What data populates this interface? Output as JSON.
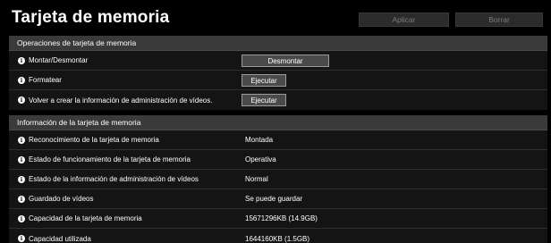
{
  "header": {
    "title": "Tarjeta de memoria",
    "apply_label": "Aplicar",
    "clear_label": "Borrar"
  },
  "operations": {
    "title": "Operaciones de tarjeta de memoria",
    "rows": [
      {
        "label": "Montar/Desmontar",
        "button": "Desmontar"
      },
      {
        "label": "Formatear",
        "button": "Ejecutar"
      },
      {
        "label": "Volver a crear la información de administración de vídeos.",
        "button": "Ejecutar"
      }
    ]
  },
  "info": {
    "title": "Información de la tarjeta de memoria",
    "rows": [
      {
        "label": "Reconocimiento de la tarjeta de memoria",
        "value": "Montada"
      },
      {
        "label": "Estado de funcionamiento de la tarjeta de memoria",
        "value": "Operativa"
      },
      {
        "label": "Estado de la información de administración de vídeos",
        "value": "Normal"
      },
      {
        "label": "Guardado de vídeos",
        "value": "Se puede guardar"
      },
      {
        "label": "Capacidad de la tarjeta de memoria",
        "value": "15671296KB (14.9GB)"
      },
      {
        "label": "Capacidad utilizada",
        "value": "1644160KB (1.5GB)"
      }
    ]
  },
  "icons": {
    "info_glyph": "i",
    "info_icon_name": "info-icon"
  },
  "colors": {
    "background": "#000000",
    "section_header": "#3a3a3a",
    "row_background": "#141414",
    "text": "#ffffff",
    "disabled_text": "#7a7a7a"
  }
}
